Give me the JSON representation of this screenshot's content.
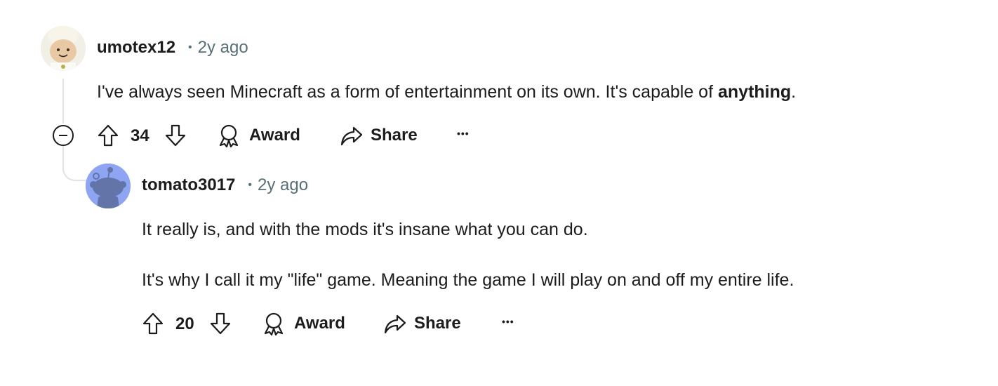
{
  "comments": [
    {
      "username": "umotex12",
      "dot": "•",
      "age": "2y ago",
      "body_prefix": "I've always seen Minecraft as a form of entertainment on its own. It's capable of ",
      "body_bold": "anything",
      "body_suffix": ".",
      "score": "34",
      "award_label": "Award",
      "share_label": "Share",
      "more_label": "•••"
    },
    {
      "username": "tomato3017",
      "dot": "•",
      "age": "2y ago",
      "paragraphs": [
        "It really is, and with the mods it's insane what you can do.",
        "It's why I call it my \"life\" game. Meaning the game I will play on and off my entire life."
      ],
      "score": "20",
      "award_label": "Award",
      "share_label": "Share",
      "more_label": "•••"
    }
  ],
  "colors": {
    "text": "#1c1c1c",
    "meta": "#576f76",
    "thread_line": "#dfe3e6",
    "snoo_bg": "#8ea5f4",
    "snoo_body": "#6274a8"
  },
  "icons": [
    "upvote-icon",
    "downvote-icon",
    "award-icon",
    "share-icon",
    "collapse-icon",
    "more-icon"
  ]
}
